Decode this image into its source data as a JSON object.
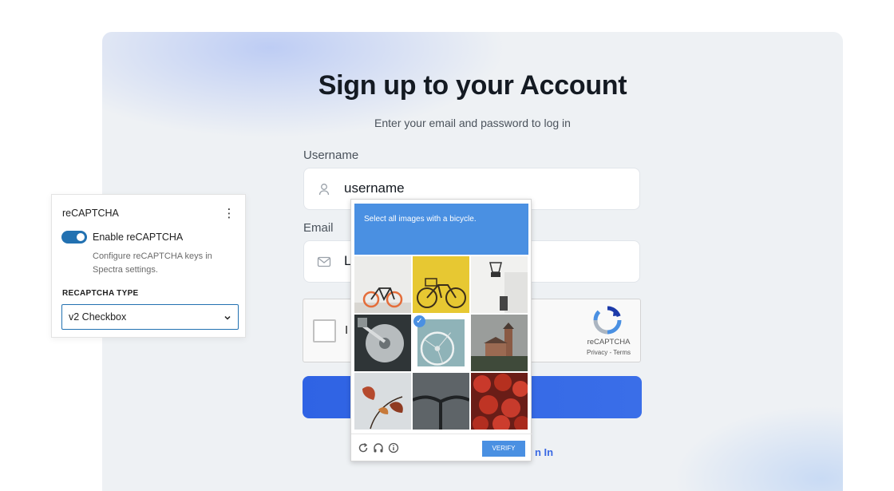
{
  "form": {
    "title": "Sign up to your Account",
    "subtitle": "Enter your email and password to log in",
    "username_label": "Username",
    "username_value": "username",
    "email_label": "Email",
    "email_value_visible": "L",
    "captcha_stub_text": "I",
    "recaptcha_brand": "reCAPTCHA",
    "recaptcha_links": "Privacy - Terms",
    "signin_link_visible": "n In",
    "button_color": "#2f63e4"
  },
  "challenge": {
    "instruction": "Select all images with a bicycle.",
    "verify_label": "VERIFY",
    "tiles": [
      {
        "subject": "orange bicycle against white wall",
        "selected": false
      },
      {
        "subject": "yellow bicycle with basket",
        "selected": false
      },
      {
        "subject": "binder clip in white room",
        "selected": false
      },
      {
        "subject": "hard disk drive",
        "selected": false
      },
      {
        "subject": "bicycle wheel",
        "selected": true
      },
      {
        "subject": "church tower",
        "selected": false
      },
      {
        "subject": "autumn leaves",
        "selected": false
      },
      {
        "subject": "bicycle handlebar",
        "selected": false
      },
      {
        "subject": "strawberries",
        "selected": false
      }
    ],
    "footer_icons": [
      "reload-icon",
      "headphones-icon",
      "info-icon"
    ],
    "accent": "#4a90e2"
  },
  "settings_panel": {
    "title": "reCAPTCHA",
    "toggle_label": "Enable reCAPTCHA",
    "toggle_on": true,
    "help_text": "Configure reCAPTCHA keys in Spectra settings.",
    "type_label": "RECAPTCHA TYPE",
    "type_value": "v2 Checkbox",
    "accent": "#2271b1"
  }
}
